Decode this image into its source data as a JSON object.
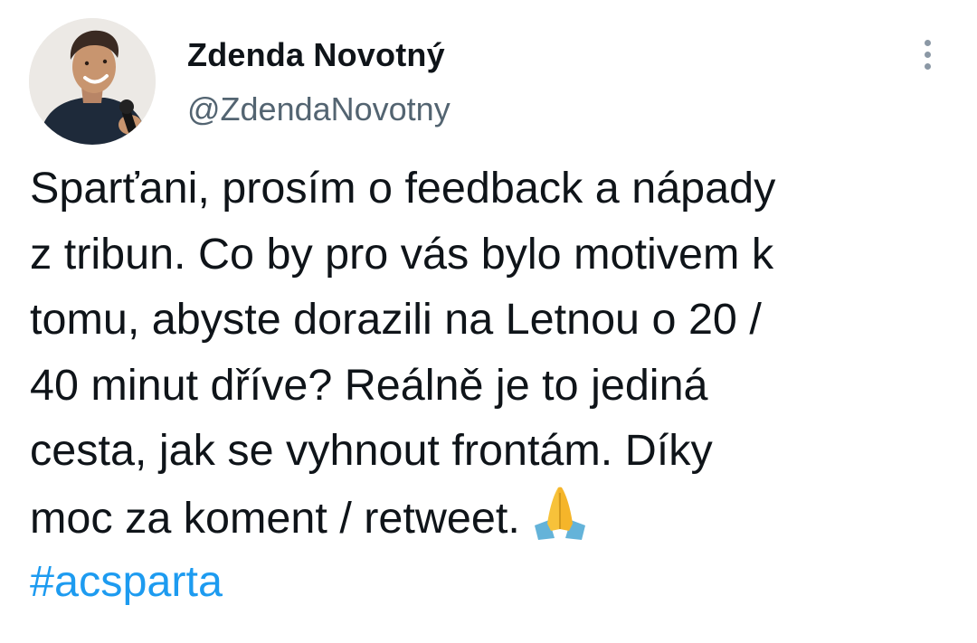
{
  "tweet": {
    "author_name": "Zdenda Novotný",
    "author_handle": "@ZdendaNovotny",
    "text_lines": [
      "Sparťani, prosím o feedback a nápady",
      "z tribun. Co by pro vás bylo motivem k",
      "tomu, abyste dorazili na Letnou o 20 /",
      "40 minut dříve? Reálně je to jediná",
      "cesta, jak se vyhnout frontám. Díky",
      "moc za koment / retweet."
    ],
    "emoji": "folded-hands",
    "hashtag": "#acsparta"
  },
  "icons": {
    "more": "more-vertical-icon",
    "avatar": "profile-photo"
  },
  "colors": {
    "text": "#0f1419",
    "secondary": "#536471",
    "link": "#1d9bf0",
    "more_dots": "#8b98a5"
  }
}
